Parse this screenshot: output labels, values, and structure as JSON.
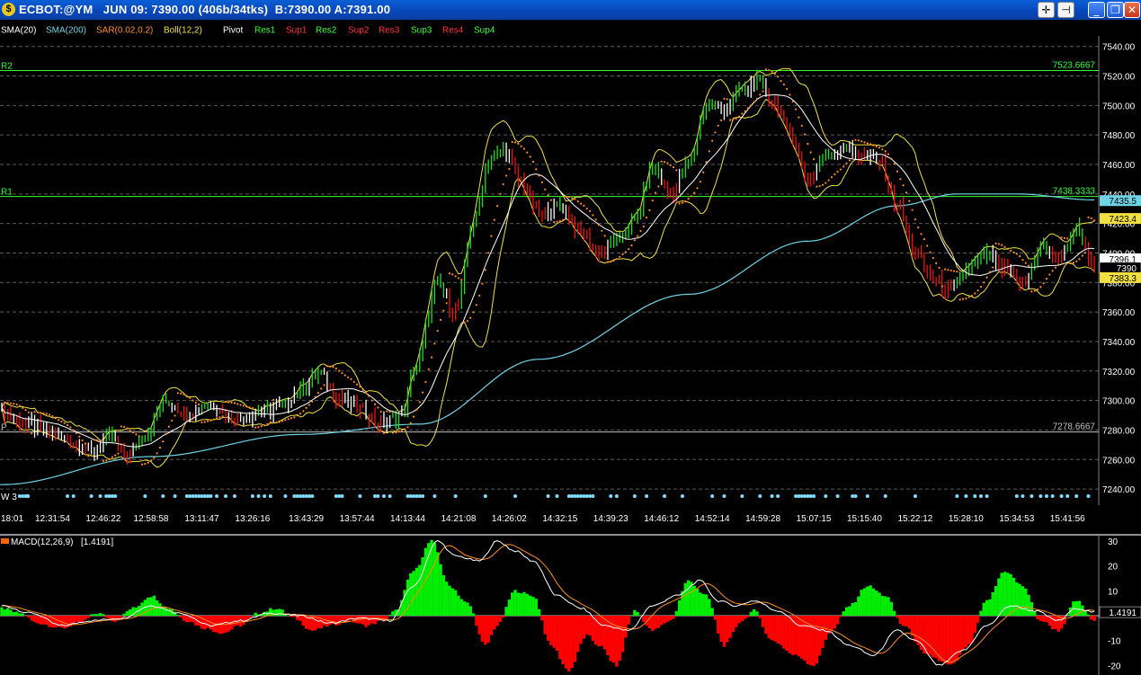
{
  "window": {
    "title": "ECBOT:@YM   JUN 09: 7390.00 (406b/34tks)  B:7390.00 A:7391.00",
    "icon": "ecbot-icon",
    "buttons": [
      {
        "name": "crosshair-button",
        "glyph": "✛"
      },
      {
        "name": "pin-button",
        "glyph": "⊣"
      },
      {
        "name": "minimize-button",
        "glyph": "_"
      },
      {
        "name": "restore-button",
        "glyph": "❐"
      },
      {
        "name": "close-button",
        "glyph": "✕"
      }
    ]
  },
  "legend": [
    {
      "text": "SMA(20)",
      "color": "#ffffff"
    },
    {
      "text": "SMA(200)",
      "color": "#6fd3e6"
    },
    {
      "text": "SAR(0.02,0.2)",
      "color": "#ff8c1a"
    },
    {
      "text": "Boll(12,2)",
      "color": "#f0e040"
    },
    {
      "text": "Pivot",
      "color": "#ffffff"
    },
    {
      "text": "Res1",
      "color": "#33ff33"
    },
    {
      "text": "Sup1",
      "color": "#ff3333"
    },
    {
      "text": "Res2",
      "color": "#33ff33"
    },
    {
      "text": "Sup2",
      "color": "#ff3333"
    },
    {
      "text": "Res3",
      "color": "#ff3333"
    },
    {
      "text": "Sup3",
      "color": "#33ff33"
    },
    {
      "text": "Res4",
      "color": "#ff3333"
    },
    {
      "text": "Sup4",
      "color": "#33ff33"
    }
  ],
  "colors": {
    "up_bar": "#22dd22",
    "down_bar": "#ee1111",
    "neutral_bar": "#ffffff",
    "sma20": "#ffffff",
    "sma200": "#6fd3e6",
    "sar": "#ff8c1a",
    "boll": "#f0e040",
    "pivot_line": "#c0c0c0",
    "resistance_line": "#33ff33",
    "macd_pos": "#00ee00",
    "macd_neg": "#ff0000",
    "macd_line": "#ffffff",
    "signal_line": "#ff8c1a"
  },
  "chart_data": [
    {
      "type": "line",
      "ylim": [
        7230,
        7545
      ],
      "yticks": [
        7240,
        7260,
        7280,
        7300,
        7320,
        7340,
        7360,
        7380,
        7400,
        7420,
        7440,
        7460,
        7480,
        7500,
        7520,
        7540
      ],
      "yticklabels": [
        "7240.00",
        "7260.00",
        "7280.00",
        "7300.00",
        "7320.00",
        "7340.00",
        "7360.00",
        "7380.00",
        "7400.00",
        "7420.00",
        "7440.00",
        "7460.00",
        "7480.00",
        "7500.00",
        "7520.00",
        "7540.00"
      ],
      "grid": true,
      "x_count": 400,
      "xlabels": [
        {
          "i": 0,
          "text": "18:01"
        },
        {
          "i": 17,
          "text": "12:31:54"
        },
        {
          "i": 34,
          "text": "12:46:22"
        },
        {
          "i": 50,
          "text": "12:58:58"
        },
        {
          "i": 67,
          "text": "13:11:47"
        },
        {
          "i": 84,
          "text": "13:26:16"
        },
        {
          "i": 102,
          "text": "13:43:29"
        },
        {
          "i": 119,
          "text": "13:57:44"
        },
        {
          "i": 136,
          "text": "14:13:44"
        },
        {
          "i": 153,
          "text": "14:21:08"
        },
        {
          "i": 170,
          "text": "14:26:02"
        },
        {
          "i": 187,
          "text": "14:32:15"
        },
        {
          "i": 204,
          "text": "14:39:23"
        },
        {
          "i": 221,
          "text": "14:46:12"
        },
        {
          "i": 238,
          "text": "14:52:14"
        },
        {
          "i": 255,
          "text": "14:59:28"
        },
        {
          "i": 272,
          "text": "15:07:15"
        },
        {
          "i": 289,
          "text": "15:15:40"
        },
        {
          "i": 306,
          "text": "15:22:12"
        },
        {
          "i": 323,
          "text": "15:28:10"
        },
        {
          "i": 340,
          "text": "15:34:53"
        },
        {
          "i": 357,
          "text": "15:41:56"
        }
      ],
      "price_anchors": [
        [
          0,
          7292
        ],
        [
          8,
          7284
        ],
        [
          16,
          7278
        ],
        [
          24,
          7272
        ],
        [
          30,
          7265
        ],
        [
          36,
          7275
        ],
        [
          42,
          7262
        ],
        [
          48,
          7278
        ],
        [
          55,
          7300
        ],
        [
          62,
          7292
        ],
        [
          70,
          7298
        ],
        [
          78,
          7288
        ],
        [
          86,
          7292
        ],
        [
          94,
          7296
        ],
        [
          100,
          7308
        ],
        [
          106,
          7318
        ],
        [
          113,
          7302
        ],
        [
          120,
          7294
        ],
        [
          127,
          7284
        ],
        [
          134,
          7290
        ],
        [
          138,
          7320
        ],
        [
          146,
          7378
        ],
        [
          152,
          7360
        ],
        [
          158,
          7420
        ],
        [
          163,
          7462
        ],
        [
          168,
          7470
        ],
        [
          174,
          7448
        ],
        [
          180,
          7426
        ],
        [
          187,
          7432
        ],
        [
          194,
          7414
        ],
        [
          200,
          7400
        ],
        [
          206,
          7408
        ],
        [
          212,
          7422
        ],
        [
          218,
          7458
        ],
        [
          224,
          7440
        ],
        [
          230,
          7460
        ],
        [
          236,
          7500
        ],
        [
          242,
          7498
        ],
        [
          248,
          7510
        ],
        [
          253,
          7516
        ],
        [
          258,
          7504
        ],
        [
          264,
          7482
        ],
        [
          270,
          7450
        ],
        [
          276,
          7466
        ],
        [
          282,
          7472
        ],
        [
          288,
          7466
        ],
        [
          294,
          7462
        ],
        [
          300,
          7432
        ],
        [
          306,
          7400
        ],
        [
          312,
          7382
        ],
        [
          318,
          7374
        ],
        [
          324,
          7390
        ],
        [
          330,
          7398
        ],
        [
          336,
          7388
        ],
        [
          342,
          7378
        ],
        [
          348,
          7404
        ],
        [
          354,
          7396
        ],
        [
          360,
          7416
        ],
        [
          366,
          7392
        ]
      ],
      "sma200_anchors": [
        [
          0,
          7243
        ],
        [
          50,
          7262
        ],
        [
          100,
          7277
        ],
        [
          140,
          7284
        ],
        [
          180,
          7328
        ],
        [
          230,
          7372
        ],
        [
          270,
          7408
        ],
        [
          300,
          7432
        ],
        [
          320,
          7440
        ],
        [
          340,
          7440
        ],
        [
          366,
          7436
        ]
      ],
      "lines": [
        {
          "name": "R2",
          "value": 7523.6667,
          "label": "7523.6667",
          "left_label": "R2"
        },
        {
          "name": "R1",
          "value": 7438.3333,
          "label": "7438.3333",
          "left_label": "R1"
        },
        {
          "name": "P",
          "value": 7278.6667,
          "label": "7278.6667",
          "left_label": "P"
        }
      ],
      "price_tags": [
        {
          "value": 7435.5,
          "text": "7435.5",
          "bg": "#6fd3e6"
        },
        {
          "value": 7423.4,
          "text": "7423.4",
          "bg": "#f0e040"
        },
        {
          "value": 7396.1,
          "text": "7396.1",
          "bg": "#ffffff"
        },
        {
          "value": 7390,
          "text": "7390",
          "bg": "#000000",
          "fg": "#ffffff"
        },
        {
          "value": 7383.3,
          "text": "7383.3",
          "bg": "#f0e040"
        }
      ],
      "marker_label": "W 3",
      "marker_positions": [
        6,
        7,
        8,
        22,
        24,
        30,
        33,
        35,
        36,
        37,
        38,
        48,
        54,
        58,
        62,
        63,
        64,
        65,
        66,
        67,
        68,
        69,
        70,
        72,
        75,
        78,
        84,
        86,
        88,
        90,
        95,
        98,
        99,
        100,
        101,
        102,
        103,
        104,
        112,
        113,
        114,
        120,
        125,
        126,
        128,
        130,
        136,
        137,
        138,
        139,
        140,
        141,
        145,
        152,
        162,
        172,
        183,
        186,
        190,
        191,
        192,
        193,
        194,
        195,
        196,
        197,
        198,
        204,
        206,
        212,
        216,
        222,
        228,
        238,
        242,
        248,
        254,
        258,
        260,
        266,
        267,
        268,
        269,
        270,
        271,
        272,
        276,
        280,
        285,
        286,
        290,
        296,
        306,
        320,
        323,
        326,
        328,
        330,
        340,
        342,
        345,
        348,
        350,
        352,
        355,
        357,
        360,
        364
      ]
    },
    {
      "type": "area",
      "name": "MACD(12,26,9)",
      "legend": "MACD(12,26,9)",
      "value_label": "[1.4191]",
      "current_tag": "1.4191",
      "ylim": [
        -22,
        34
      ],
      "yticks": [
        -20,
        -10,
        10,
        20,
        30
      ],
      "yticklabels": [
        "-20",
        "-10",
        "10",
        "20",
        "30"
      ],
      "hist_anchors": [
        [
          0,
          3
        ],
        [
          6,
          1
        ],
        [
          12,
          -3
        ],
        [
          20,
          -5
        ],
        [
          26,
          -3
        ],
        [
          32,
          1
        ],
        [
          38,
          -2
        ],
        [
          44,
          3
        ],
        [
          50,
          8
        ],
        [
          56,
          3
        ],
        [
          62,
          -2
        ],
        [
          68,
          -5
        ],
        [
          74,
          -7
        ],
        [
          80,
          -4
        ],
        [
          86,
          1
        ],
        [
          92,
          3
        ],
        [
          98,
          -1
        ],
        [
          104,
          -6
        ],
        [
          110,
          -4
        ],
        [
          116,
          -2
        ],
        [
          122,
          -4
        ],
        [
          128,
          -2
        ],
        [
          132,
          2
        ],
        [
          138,
          18
        ],
        [
          144,
          30
        ],
        [
          150,
          12
        ],
        [
          156,
          5
        ],
        [
          162,
          -12
        ],
        [
          166,
          -4
        ],
        [
          172,
          10
        ],
        [
          178,
          8
        ],
        [
          184,
          -12
        ],
        [
          190,
          -22
        ],
        [
          196,
          -8
        ],
        [
          200,
          -12
        ],
        [
          206,
          -20
        ],
        [
          212,
          2
        ],
        [
          218,
          -6
        ],
        [
          224,
          -2
        ],
        [
          230,
          14
        ],
        [
          236,
          8
        ],
        [
          242,
          -12
        ],
        [
          248,
          -2
        ],
        [
          252,
          2
        ],
        [
          258,
          -10
        ],
        [
          266,
          -16
        ],
        [
          272,
          -20
        ],
        [
          278,
          -6
        ],
        [
          284,
          4
        ],
        [
          290,
          12
        ],
        [
          296,
          8
        ],
        [
          302,
          -4
        ],
        [
          310,
          -16
        ],
        [
          318,
          -20
        ],
        [
          324,
          -12
        ],
        [
          330,
          6
        ],
        [
          336,
          18
        ],
        [
          342,
          12
        ],
        [
          348,
          -2
        ],
        [
          354,
          -6
        ],
        [
          360,
          6
        ],
        [
          366,
          -2
        ]
      ],
      "macd_anchors": [
        [
          0,
          4
        ],
        [
          10,
          1
        ],
        [
          20,
          -4
        ],
        [
          30,
          -2
        ],
        [
          40,
          -1
        ],
        [
          50,
          4
        ],
        [
          60,
          1
        ],
        [
          70,
          -4
        ],
        [
          80,
          -2
        ],
        [
          90,
          1
        ],
        [
          100,
          0
        ],
        [
          110,
          -3
        ],
        [
          120,
          -1
        ],
        [
          130,
          -2
        ],
        [
          138,
          12
        ],
        [
          146,
          30
        ],
        [
          152,
          24
        ],
        [
          160,
          22
        ],
        [
          166,
          30
        ],
        [
          172,
          26
        ],
        [
          178,
          22
        ],
        [
          186,
          8
        ],
        [
          194,
          3
        ],
        [
          202,
          -4
        ],
        [
          210,
          -6
        ],
        [
          218,
          4
        ],
        [
          226,
          8
        ],
        [
          234,
          14
        ],
        [
          240,
          6
        ],
        [
          246,
          4
        ],
        [
          252,
          6
        ],
        [
          260,
          2
        ],
        [
          268,
          -4
        ],
        [
          276,
          -6
        ],
        [
          284,
          -12
        ],
        [
          292,
          -16
        ],
        [
          300,
          -6
        ],
        [
          306,
          -10
        ],
        [
          314,
          -20
        ],
        [
          322,
          -14
        ],
        [
          330,
          -4
        ],
        [
          338,
          4
        ],
        [
          346,
          2
        ],
        [
          354,
          -2
        ],
        [
          360,
          3
        ],
        [
          366,
          1.4191
        ]
      ]
    }
  ]
}
